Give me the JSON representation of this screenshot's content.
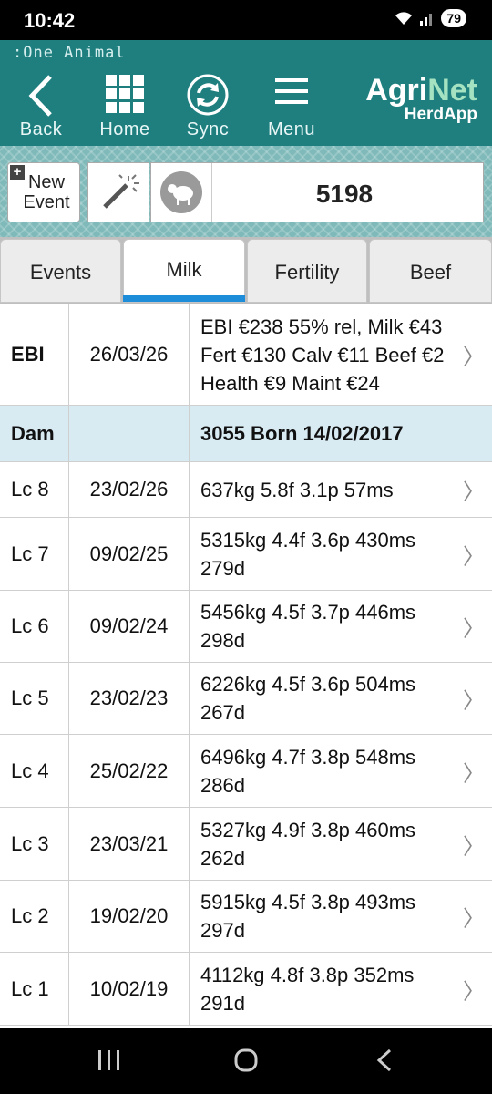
{
  "status": {
    "time": "10:42",
    "battery": "79"
  },
  "header": {
    "crumb": ":One Animal",
    "buttons": {
      "back": "Back",
      "home": "Home",
      "sync": "Sync",
      "menu": "Menu"
    },
    "brand_main_a": "Agri",
    "brand_main_b": "Net",
    "brand_sub": "HerdApp"
  },
  "toolbar": {
    "new_event_label": "New Event",
    "animal_number": "5198"
  },
  "tabs": [
    "Events",
    "Milk",
    "Fertility",
    "Beef"
  ],
  "active_tab": "Milk",
  "rows": [
    {
      "label": "EBI",
      "date": "26/03/26",
      "detail": "EBI €238 55% rel, Milk €43 Fert €130 Calv €11 Beef €2 Health €9 Maint €24"
    },
    {
      "label": "Dam",
      "date": "",
      "detail": "3055 Born 14/02/2017"
    },
    {
      "label": "Lc 8",
      "date": "23/02/26",
      "detail": "637kg 5.8f 3.1p 57ms"
    },
    {
      "label": "Lc 7",
      "date": "09/02/25",
      "detail": "5315kg 4.4f 3.6p 430ms 279d"
    },
    {
      "label": "Lc 6",
      "date": "09/02/24",
      "detail": "5456kg 4.5f 3.7p 446ms 298d"
    },
    {
      "label": "Lc 5",
      "date": "23/02/23",
      "detail": "6226kg 4.5f 3.6p 504ms 267d"
    },
    {
      "label": "Lc 4",
      "date": "25/02/22",
      "detail": "6496kg 4.7f 3.8p 548ms 286d"
    },
    {
      "label": "Lc 3",
      "date": "23/03/21",
      "detail": "5327kg 4.9f 3.8p 460ms 262d"
    },
    {
      "label": "Lc 2",
      "date": "19/02/20",
      "detail": "5915kg 4.5f 3.8p 493ms 297d"
    },
    {
      "label": "Lc 1",
      "date": "10/02/19",
      "detail": "4112kg 4.8f 3.8p 352ms 291d"
    }
  ],
  "colors": {
    "header": "#1f7f7f",
    "tab_underline": "#1e8dd9",
    "dam_row": "#d8eaf2"
  }
}
